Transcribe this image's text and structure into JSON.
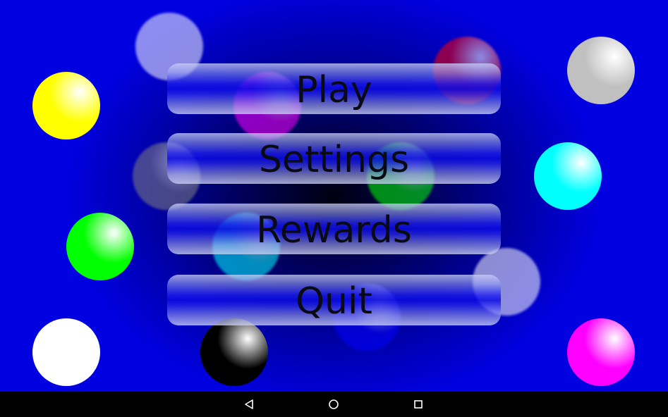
{
  "menu": {
    "play_label": "Play",
    "settings_label": "Settings",
    "rewards_label": "Rewards",
    "quit_label": "Quit"
  },
  "balls": [
    {
      "color": "#ffff00",
      "faded": false
    },
    {
      "color": "#ffffff",
      "faded": true
    },
    {
      "color": "#ff0000",
      "faded": true
    },
    {
      "color": "#c0c0c0",
      "faded": false
    },
    {
      "color": "#ff00ff",
      "faded": true
    },
    {
      "color": "#808080",
      "faded": true
    },
    {
      "color": "#00ff00",
      "faded": true
    },
    {
      "color": "#00ffff",
      "faded": false
    },
    {
      "color": "#00ff00",
      "faded": false
    },
    {
      "color": "#00ffff",
      "faded": true
    },
    {
      "color": "#ffffff",
      "faded": true
    },
    {
      "color": "#0000ff",
      "faded": true
    },
    {
      "color": "#ffffff",
      "faded": false
    },
    {
      "color": "#000000",
      "faded": false
    },
    {
      "color": "#ff00ff",
      "faded": false
    }
  ],
  "navigation_bar": {
    "back_icon": "triangle-back-icon",
    "home_icon": "circle-home-icon",
    "recents_icon": "square-recents-icon"
  }
}
